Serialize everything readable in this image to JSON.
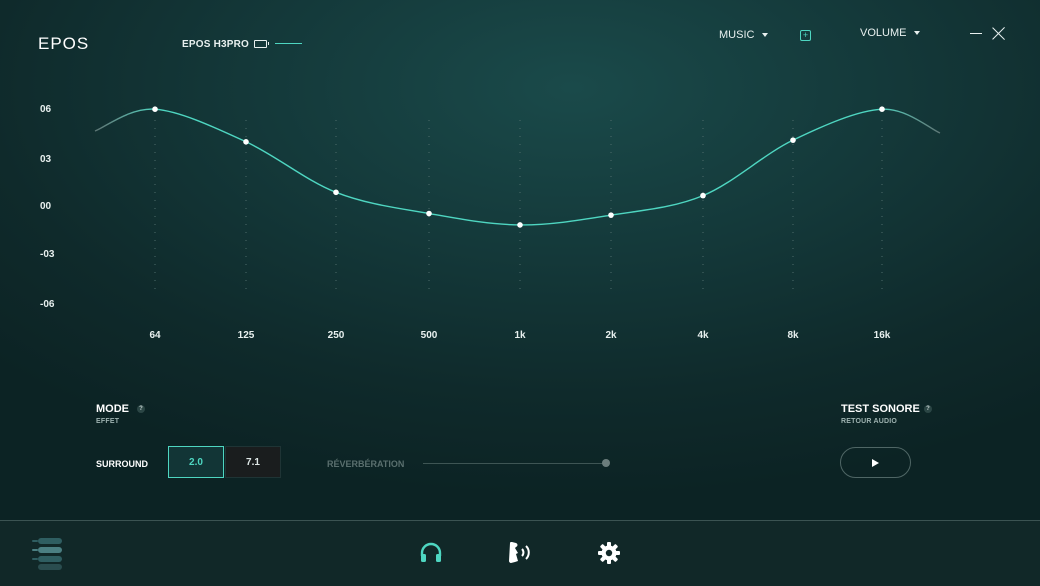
{
  "header": {
    "logo": "EPOS",
    "device_name": "EPOS H3PRO",
    "profile_dropdown": "MUSIC",
    "volume_dropdown": "VOLUME"
  },
  "colors": {
    "accent": "#4ed6c1",
    "text": "#e8f0ef",
    "muted": "#9fb3b1",
    "background": "#14393a"
  },
  "equalizer": {
    "y_labels": [
      "06",
      "03",
      "00",
      "-03",
      "-06"
    ],
    "ylim": [
      -6,
      6
    ],
    "bands": [
      {
        "label": "64",
        "gain": 6
      },
      {
        "label": "125",
        "gain": 4
      },
      {
        "label": "250",
        "gain": 0.9
      },
      {
        "label": "500",
        "gain": -0.4
      },
      {
        "label": "1k",
        "gain": -1.1
      },
      {
        "label": "2k",
        "gain": -0.5
      },
      {
        "label": "4k",
        "gain": 0.7
      },
      {
        "label": "8k",
        "gain": 4.1
      },
      {
        "label": "16k",
        "gain": 6
      }
    ]
  },
  "mode": {
    "title": "MODE",
    "subtitle": "EFFET",
    "help": "?",
    "surround_label": "SURROUND",
    "options": [
      "2.0",
      "7.1"
    ],
    "selected": "2.0",
    "reverb_label": "RÉVERBÉRATION"
  },
  "test": {
    "title": "TEST SONORE",
    "subtitle": "RETOUR AUDIO",
    "help": "?"
  },
  "bottom_nav": {
    "icons": [
      "menu-icon",
      "headphones-icon",
      "sidetone-icon",
      "settings-icon"
    ],
    "active": "headphones-icon"
  }
}
